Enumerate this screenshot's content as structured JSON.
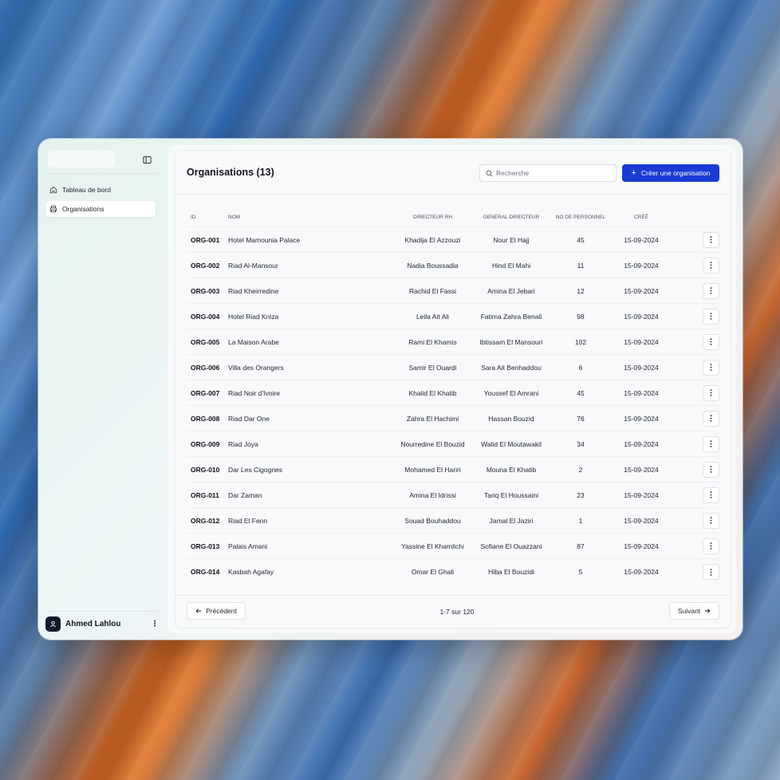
{
  "sidebar": {
    "items": [
      {
        "label": "Tableau de bord",
        "icon": "home-icon",
        "active": false
      },
      {
        "label": "Organisations",
        "icon": "printer-icon",
        "active": true
      }
    ],
    "user": {
      "name": "Ahmed Lahlou",
      "icon": "user-icon"
    }
  },
  "header": {
    "title": "Organisations (13)",
    "search_placeholder": "Recherche",
    "create_label": "Créer une organisation"
  },
  "table": {
    "columns": {
      "id": "ID",
      "nom": "NOM",
      "directeur_rh": "DIRECTEUR RH",
      "general_directeur": "GENERAL DIRECTEUR",
      "personnel": "NO DE PERSONNEL",
      "cree": "CRÉÉ"
    },
    "rows": [
      {
        "id": "ORG-001",
        "nom": "Hotel Mamounia Palace",
        "directeur_rh": "Khadija El Azzouzi",
        "general_directeur": "Nour El Hajj",
        "personnel": "45",
        "cree": "15-09-2024"
      },
      {
        "id": "ORG-002",
        "nom": "Riad Al-Mansour",
        "directeur_rh": "Nadia Boussadia",
        "general_directeur": "Hind El Mahi",
        "personnel": "11",
        "cree": "15-09-2024"
      },
      {
        "id": "ORG-003",
        "nom": "Riad Kheirredine",
        "directeur_rh": "Rachid El Fassi",
        "general_directeur": "Amina El Jebari",
        "personnel": "12",
        "cree": "15-09-2024"
      },
      {
        "id": "ORG-004",
        "nom": "Hotel Riad Kniza",
        "directeur_rh": "Leila Ait Ali",
        "general_directeur": "Fatima Zahra Benali",
        "personnel": "98",
        "cree": "15-09-2024"
      },
      {
        "id": "ORG-005",
        "nom": "La Maison Arabe",
        "directeur_rh": "Rami El Khamis",
        "general_directeur": "Ibtissam El Mansouri",
        "personnel": "102",
        "cree": "15-09-2024"
      },
      {
        "id": "ORG-006",
        "nom": "Villa des Orangers",
        "directeur_rh": "Samir El Ouardi",
        "general_directeur": "Sara Ait Benhaddou",
        "personnel": "6",
        "cree": "15-09-2024"
      },
      {
        "id": "ORG-007",
        "nom": "Riad Noir d'Ivoire",
        "directeur_rh": "Khalid El Khatib",
        "general_directeur": "Youssef El Amrani",
        "personnel": "45",
        "cree": "15-09-2024"
      },
      {
        "id": "ORG-008",
        "nom": "Riad Dar One",
        "directeur_rh": "Zahra El Hachimi",
        "general_directeur": "Hassan Bouzid",
        "personnel": "76",
        "cree": "15-09-2024"
      },
      {
        "id": "ORG-009",
        "nom": "Riad Joya",
        "directeur_rh": "Nourredine El Bouzid",
        "general_directeur": "Walid El Moutawakil",
        "personnel": "34",
        "cree": "15-09-2024"
      },
      {
        "id": "ORG-010",
        "nom": "Dar Les Cigognes",
        "directeur_rh": "Mohamed El Hariri",
        "general_directeur": "Mouna El Khatib",
        "personnel": "2",
        "cree": "15-09-2024"
      },
      {
        "id": "ORG-011",
        "nom": "Dar Zaman",
        "directeur_rh": "Amina El Idrissi",
        "general_directeur": "Tariq El Houssaini",
        "personnel": "23",
        "cree": "15-09-2024"
      },
      {
        "id": "ORG-012",
        "nom": "Riad El Fenn",
        "directeur_rh": "Souad Bouhaddou",
        "general_directeur": "Jamal El Jaziri",
        "personnel": "1",
        "cree": "15-09-2024"
      },
      {
        "id": "ORG-013",
        "nom": "Palais Amani",
        "directeur_rh": "Yassine El Khamlichi",
        "general_directeur": "Sofiane El Ouazzani",
        "personnel": "87",
        "cree": "15-09-2024"
      },
      {
        "id": "ORG-014",
        "nom": "Kasbah Agafay",
        "directeur_rh": "Omar El Ghali",
        "general_directeur": "Hiba El Bouzidi",
        "personnel": "5",
        "cree": "15-09-2024"
      }
    ]
  },
  "pagination": {
    "prev_label": "Précédent",
    "next_label": "Suivant",
    "info": "1-7 sur 120"
  },
  "colors": {
    "accent": "#1a3bd4",
    "avatar_bg": "#151a2e"
  }
}
